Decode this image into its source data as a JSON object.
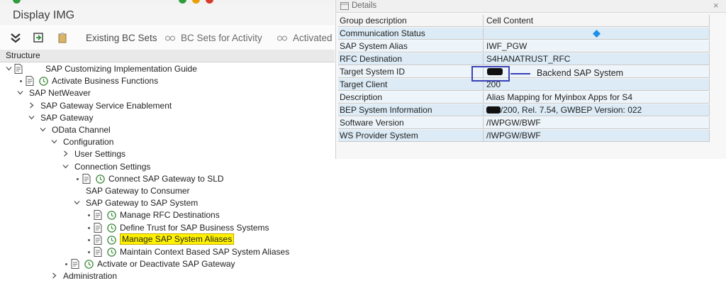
{
  "window": {
    "title": "Display IMG"
  },
  "toolbar": {
    "existing_bc_sets": "Existing BC Sets",
    "bc_sets_for_activity": "BC Sets for Activity",
    "activated": "Activated"
  },
  "tree": {
    "header": "Structure",
    "nodes": [
      {
        "label": "SAP Customizing Implementation Guide"
      },
      {
        "label": "Activate Business Functions"
      },
      {
        "label": "SAP NetWeaver"
      },
      {
        "label": "SAP Gateway Service Enablement"
      },
      {
        "label": "SAP Gateway"
      },
      {
        "label": "OData Channel"
      },
      {
        "label": "Configuration"
      },
      {
        "label": "User Settings"
      },
      {
        "label": "Connection Settings"
      },
      {
        "label": "Connect SAP Gateway to SLD"
      },
      {
        "label": "SAP Gateway to Consumer"
      },
      {
        "label": "SAP Gateway to SAP System"
      },
      {
        "label": "Manage RFC Destinations"
      },
      {
        "label": "Define Trust for SAP Business Systems"
      },
      {
        "label": "Manage SAP System Aliases"
      },
      {
        "label": "Maintain Context Based SAP System Aliases"
      },
      {
        "label": "Activate or Deactivate SAP Gateway"
      },
      {
        "label": "Administration"
      }
    ]
  },
  "details": {
    "title": "Details",
    "columns": [
      "Group description",
      "Cell Content"
    ],
    "rows": [
      {
        "label": "Communication Status",
        "value": ""
      },
      {
        "label": "SAP System Alias",
        "value": "IWF_PGW"
      },
      {
        "label": "RFC Destination",
        "value": "S4HANATRUST_RFC"
      },
      {
        "label": "Target System ID",
        "value": ""
      },
      {
        "label": "Target Client",
        "value": "200"
      },
      {
        "label": "Description",
        "value": "Alias Mapping for Myinbox Apps for S4"
      },
      {
        "label": "BEP System Information",
        "value": "/200, Rel. 7.54, GWBEP Version: 022"
      },
      {
        "label": "Software Version",
        "value": "/IWPGW/BWF"
      },
      {
        "label": "WS Provider System",
        "value": "/IWPGW/BWF"
      }
    ],
    "annotation": "Backend SAP System",
    "colors": {
      "status_diamond": "#1e90e6",
      "highlight": "#fff200",
      "annotation_box": "#3a43b8"
    }
  }
}
